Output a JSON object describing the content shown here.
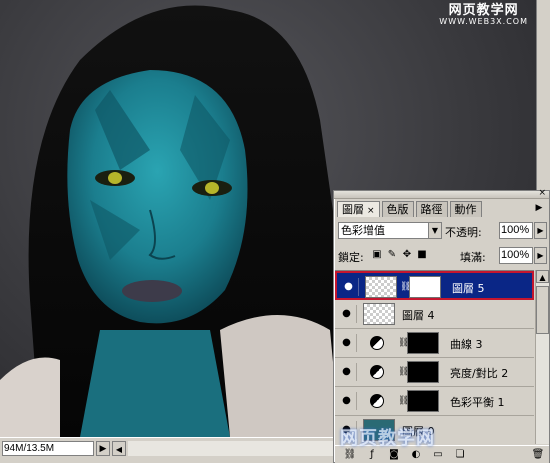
{
  "watermark": {
    "line1": "网页教学网",
    "line2": "WWW.WEB3X.COM",
    "bottom": "网页教学网"
  },
  "status_bar": {
    "doc_size": "94M/13.5M",
    "menu_arrow": "▶",
    "scroll_left": "◀"
  },
  "panel": {
    "tabs": [
      {
        "label": "圖層",
        "close": "×",
        "active": true
      },
      {
        "label": "色版",
        "active": false
      },
      {
        "label": "路徑",
        "active": false
      },
      {
        "label": "動作",
        "active": false
      }
    ],
    "menu_button": "▶",
    "blend_mode": "色彩增值",
    "opacity_label": "不透明:",
    "opacity_value": "100%",
    "lock_label": "鎖定:",
    "fill_label": "填滿:",
    "fill_value": "100%",
    "lock_icons": [
      "lock-transparency-icon",
      "lock-paint-icon",
      "lock-move-icon",
      "lock-all-icon"
    ],
    "layers": [
      {
        "name": "圖層 5",
        "visible": true,
        "selected": true,
        "type": "pixel-with-mask"
      },
      {
        "name": "圖層 4",
        "visible": true,
        "selected": false,
        "type": "pixel"
      },
      {
        "name": "曲線 3",
        "visible": true,
        "selected": false,
        "type": "adjustment"
      },
      {
        "name": "亮度/對比 2",
        "visible": true,
        "selected": false,
        "type": "adjustment"
      },
      {
        "name": "色彩平衡 1",
        "visible": true,
        "selected": false,
        "type": "adjustment"
      },
      {
        "name": "圖層 0",
        "visible": true,
        "selected": false,
        "type": "pixel"
      }
    ]
  },
  "colors": {
    "selection_fill": "#0a2686",
    "selection_border": "#c4162e",
    "skin": "#1f8c9c"
  }
}
